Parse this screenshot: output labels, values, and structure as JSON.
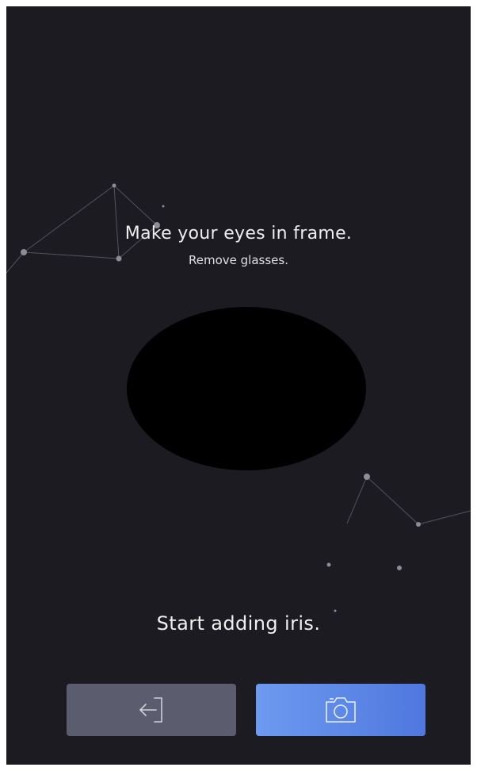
{
  "instructions": {
    "title": "Make your eyes in frame.",
    "subtitle": "Remove glasses."
  },
  "status": {
    "text": "Start adding iris."
  },
  "buttons": {
    "back": {
      "icon": "exit-icon"
    },
    "capture": {
      "icon": "camera-icon"
    }
  },
  "colors": {
    "background": "#1c1b22",
    "back_button": "#5b5c6e",
    "capture_button_start": "#6e9af0",
    "capture_button_end": "#4f77de",
    "iris_frame": "#000000"
  }
}
